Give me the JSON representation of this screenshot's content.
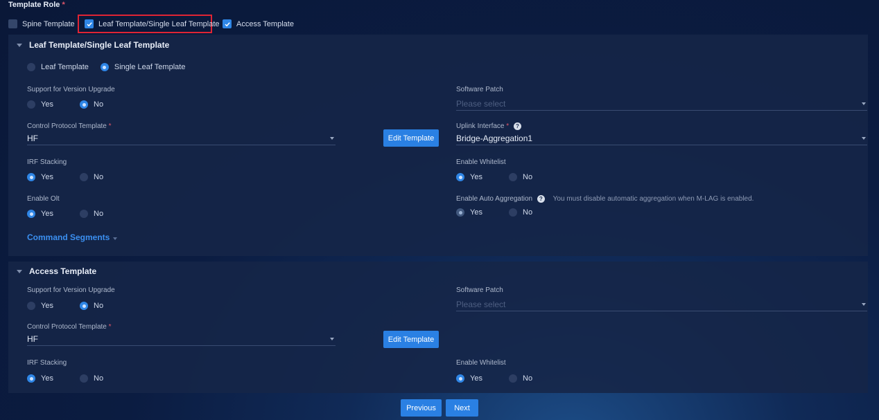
{
  "template_role": {
    "title": "Template Role",
    "required_mark": "*",
    "options": [
      {
        "label": "Spine Template",
        "checked": false
      },
      {
        "label": "Leaf Template/Single Leaf Template",
        "checked": true
      },
      {
        "label": "Access Template",
        "checked": true
      }
    ]
  },
  "leaf_section": {
    "title": "Leaf Template/Single Leaf Template",
    "type_options": [
      "Leaf Template",
      "Single Leaf Template"
    ],
    "type_selected": "Single Leaf Template",
    "version_upgrade": {
      "label": "Support for Version Upgrade",
      "options": [
        "Yes",
        "No"
      ],
      "selected": "No"
    },
    "control_protocol": {
      "label": "Control Protocol Template",
      "required_mark": "*",
      "value": "HF"
    },
    "edit_template_label": "Edit Template",
    "irf_stacking": {
      "label": "IRF Stacking",
      "options": [
        "Yes",
        "No"
      ],
      "selected": "Yes"
    },
    "enable_olt": {
      "label": "Enable Olt",
      "options": [
        "Yes",
        "No"
      ],
      "selected": "Yes"
    },
    "command_segments_label": "Command Segments",
    "software_patch": {
      "label": "Software Patch",
      "placeholder": "Please select"
    },
    "uplink_interface": {
      "label": "Uplink Interface",
      "required_mark": "*",
      "help": "?",
      "value": "Bridge-Aggregation1"
    },
    "enable_whitelist": {
      "label": "Enable Whitelist",
      "options": [
        "Yes",
        "No"
      ],
      "selected": "Yes"
    },
    "auto_aggregation": {
      "label": "Enable Auto Aggregation",
      "help": "?",
      "hint": "You must disable automatic aggregation when M-LAG is enabled.",
      "options": [
        "Yes",
        "No"
      ],
      "selected": "Yes",
      "disabled": true
    }
  },
  "access_section": {
    "title": "Access Template",
    "version_upgrade": {
      "label": "Support for Version Upgrade",
      "options": [
        "Yes",
        "No"
      ],
      "selected": "No"
    },
    "control_protocol": {
      "label": "Control Protocol Template",
      "required_mark": "*",
      "value": "HF"
    },
    "edit_template_label": "Edit Template",
    "irf_stacking": {
      "label": "IRF Stacking",
      "options": [
        "Yes",
        "No"
      ],
      "selected": "Yes"
    },
    "software_patch": {
      "label": "Software Patch",
      "placeholder": "Please select"
    },
    "enable_whitelist": {
      "label": "Enable Whitelist",
      "options": [
        "Yes",
        "No"
      ],
      "selected": "Yes"
    }
  },
  "footer": {
    "previous_label": "Previous",
    "next_label": "Next"
  },
  "colors": {
    "accent": "#2a80e3",
    "highlight": "#e02434",
    "panel": "#162648",
    "background": "#0b1c41"
  },
  "icons": {
    "checkbox_checked": "check-icon",
    "collapse": "caret-down-icon",
    "dropdown": "dropdown-arrow-icon",
    "help": "question-circle-icon"
  }
}
